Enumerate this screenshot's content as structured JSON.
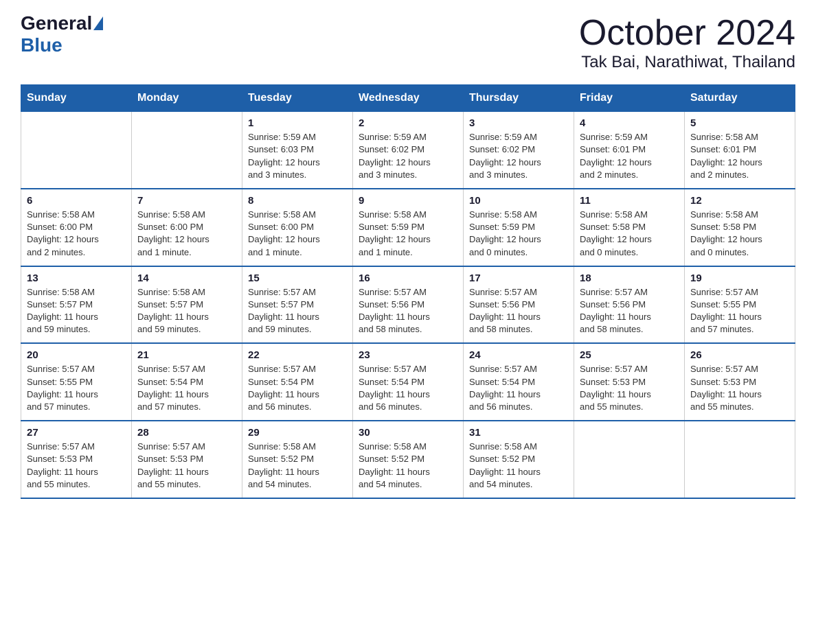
{
  "header": {
    "logo_general": "General",
    "logo_blue": "Blue",
    "title": "October 2024",
    "subtitle": "Tak Bai, Narathiwat, Thailand"
  },
  "weekdays": [
    "Sunday",
    "Monday",
    "Tuesday",
    "Wednesday",
    "Thursday",
    "Friday",
    "Saturday"
  ],
  "weeks": [
    [
      {
        "day": "",
        "info": ""
      },
      {
        "day": "",
        "info": ""
      },
      {
        "day": "1",
        "info": "Sunrise: 5:59 AM\nSunset: 6:03 PM\nDaylight: 12 hours\nand 3 minutes."
      },
      {
        "day": "2",
        "info": "Sunrise: 5:59 AM\nSunset: 6:02 PM\nDaylight: 12 hours\nand 3 minutes."
      },
      {
        "day": "3",
        "info": "Sunrise: 5:59 AM\nSunset: 6:02 PM\nDaylight: 12 hours\nand 3 minutes."
      },
      {
        "day": "4",
        "info": "Sunrise: 5:59 AM\nSunset: 6:01 PM\nDaylight: 12 hours\nand 2 minutes."
      },
      {
        "day": "5",
        "info": "Sunrise: 5:58 AM\nSunset: 6:01 PM\nDaylight: 12 hours\nand 2 minutes."
      }
    ],
    [
      {
        "day": "6",
        "info": "Sunrise: 5:58 AM\nSunset: 6:00 PM\nDaylight: 12 hours\nand 2 minutes."
      },
      {
        "day": "7",
        "info": "Sunrise: 5:58 AM\nSunset: 6:00 PM\nDaylight: 12 hours\nand 1 minute."
      },
      {
        "day": "8",
        "info": "Sunrise: 5:58 AM\nSunset: 6:00 PM\nDaylight: 12 hours\nand 1 minute."
      },
      {
        "day": "9",
        "info": "Sunrise: 5:58 AM\nSunset: 5:59 PM\nDaylight: 12 hours\nand 1 minute."
      },
      {
        "day": "10",
        "info": "Sunrise: 5:58 AM\nSunset: 5:59 PM\nDaylight: 12 hours\nand 0 minutes."
      },
      {
        "day": "11",
        "info": "Sunrise: 5:58 AM\nSunset: 5:58 PM\nDaylight: 12 hours\nand 0 minutes."
      },
      {
        "day": "12",
        "info": "Sunrise: 5:58 AM\nSunset: 5:58 PM\nDaylight: 12 hours\nand 0 minutes."
      }
    ],
    [
      {
        "day": "13",
        "info": "Sunrise: 5:58 AM\nSunset: 5:57 PM\nDaylight: 11 hours\nand 59 minutes."
      },
      {
        "day": "14",
        "info": "Sunrise: 5:58 AM\nSunset: 5:57 PM\nDaylight: 11 hours\nand 59 minutes."
      },
      {
        "day": "15",
        "info": "Sunrise: 5:57 AM\nSunset: 5:57 PM\nDaylight: 11 hours\nand 59 minutes."
      },
      {
        "day": "16",
        "info": "Sunrise: 5:57 AM\nSunset: 5:56 PM\nDaylight: 11 hours\nand 58 minutes."
      },
      {
        "day": "17",
        "info": "Sunrise: 5:57 AM\nSunset: 5:56 PM\nDaylight: 11 hours\nand 58 minutes."
      },
      {
        "day": "18",
        "info": "Sunrise: 5:57 AM\nSunset: 5:56 PM\nDaylight: 11 hours\nand 58 minutes."
      },
      {
        "day": "19",
        "info": "Sunrise: 5:57 AM\nSunset: 5:55 PM\nDaylight: 11 hours\nand 57 minutes."
      }
    ],
    [
      {
        "day": "20",
        "info": "Sunrise: 5:57 AM\nSunset: 5:55 PM\nDaylight: 11 hours\nand 57 minutes."
      },
      {
        "day": "21",
        "info": "Sunrise: 5:57 AM\nSunset: 5:54 PM\nDaylight: 11 hours\nand 57 minutes."
      },
      {
        "day": "22",
        "info": "Sunrise: 5:57 AM\nSunset: 5:54 PM\nDaylight: 11 hours\nand 56 minutes."
      },
      {
        "day": "23",
        "info": "Sunrise: 5:57 AM\nSunset: 5:54 PM\nDaylight: 11 hours\nand 56 minutes."
      },
      {
        "day": "24",
        "info": "Sunrise: 5:57 AM\nSunset: 5:54 PM\nDaylight: 11 hours\nand 56 minutes."
      },
      {
        "day": "25",
        "info": "Sunrise: 5:57 AM\nSunset: 5:53 PM\nDaylight: 11 hours\nand 55 minutes."
      },
      {
        "day": "26",
        "info": "Sunrise: 5:57 AM\nSunset: 5:53 PM\nDaylight: 11 hours\nand 55 minutes."
      }
    ],
    [
      {
        "day": "27",
        "info": "Sunrise: 5:57 AM\nSunset: 5:53 PM\nDaylight: 11 hours\nand 55 minutes."
      },
      {
        "day": "28",
        "info": "Sunrise: 5:57 AM\nSunset: 5:53 PM\nDaylight: 11 hours\nand 55 minutes."
      },
      {
        "day": "29",
        "info": "Sunrise: 5:58 AM\nSunset: 5:52 PM\nDaylight: 11 hours\nand 54 minutes."
      },
      {
        "day": "30",
        "info": "Sunrise: 5:58 AM\nSunset: 5:52 PM\nDaylight: 11 hours\nand 54 minutes."
      },
      {
        "day": "31",
        "info": "Sunrise: 5:58 AM\nSunset: 5:52 PM\nDaylight: 11 hours\nand 54 minutes."
      },
      {
        "day": "",
        "info": ""
      },
      {
        "day": "",
        "info": ""
      }
    ]
  ]
}
